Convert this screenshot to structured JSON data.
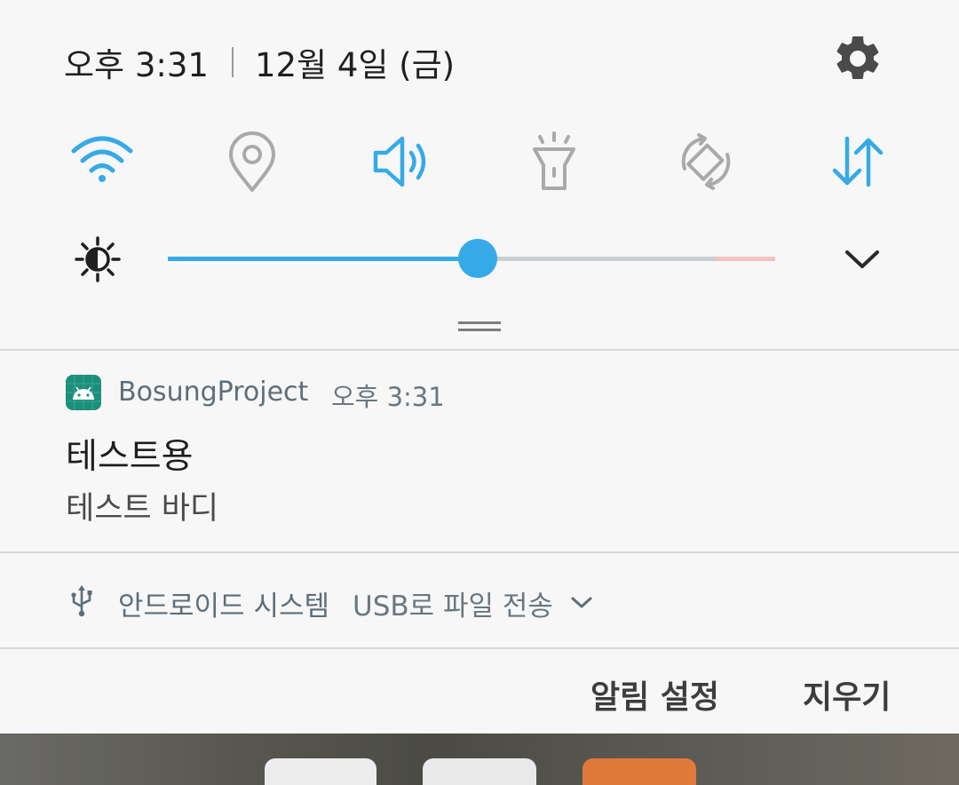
{
  "status": {
    "time": "오후 3:31",
    "date": "12월 4일 (금)"
  },
  "quick_settings": [
    {
      "name": "wifi-icon",
      "active": true
    },
    {
      "name": "location-icon",
      "active": false
    },
    {
      "name": "sound-icon",
      "active": true
    },
    {
      "name": "flashlight-icon",
      "active": false
    },
    {
      "name": "auto-rotate-icon",
      "active": false
    },
    {
      "name": "mobile-data-icon",
      "active": true
    }
  ],
  "brightness": {
    "level": 0.51
  },
  "colors": {
    "accent": "#36aae7",
    "inactive_icon": "#a9a9a9",
    "track_off": "#c9cfd1",
    "track_warn": "#f2c3c0"
  },
  "notification": {
    "app_name": "BosungProject",
    "time": "오후 3:31",
    "title": "테스트용",
    "body": "테스트 바디"
  },
  "system_notification": {
    "app_name": "안드로이드 시스템",
    "text": "USB로 파일 전송"
  },
  "actions": {
    "settings_label": "알림 설정",
    "clear_label": "지우기"
  }
}
